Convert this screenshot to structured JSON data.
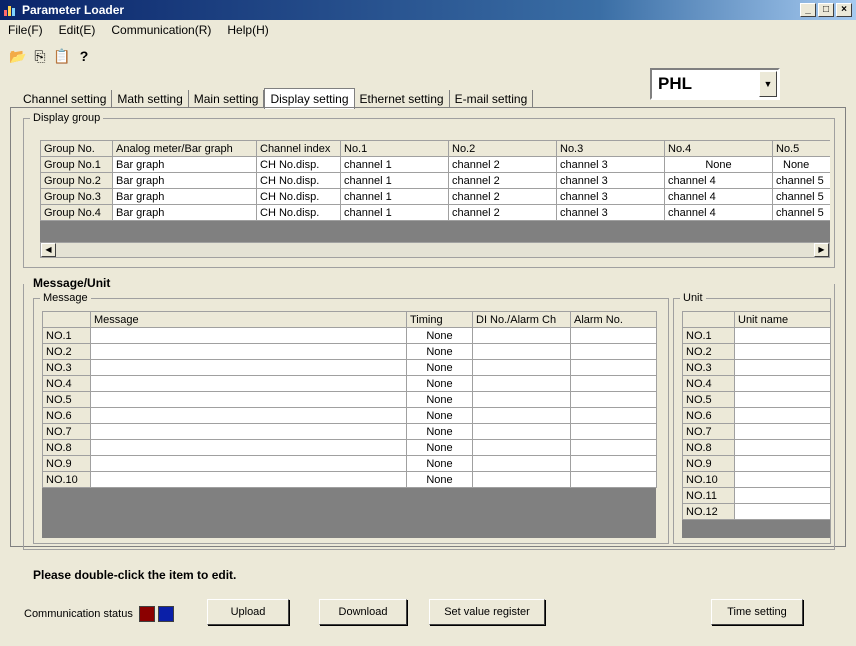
{
  "window": {
    "title": "Parameter Loader",
    "buttons": [
      "_",
      "□",
      "×"
    ]
  },
  "menu": [
    "File(F)",
    "Edit(E)",
    "Communication(R)",
    "Help(H)"
  ],
  "toolbar": {
    "icons": [
      "open-folder-icon",
      "copy-icon",
      "paste-icon",
      "help-icon"
    ],
    "glyphs": [
      "📂",
      "⎘",
      "📋",
      "?"
    ]
  },
  "model_select": {
    "value": "PHL"
  },
  "tabs": [
    {
      "label": "Channel setting",
      "active": false
    },
    {
      "label": "Math setting",
      "active": false
    },
    {
      "label": "Main setting",
      "active": false
    },
    {
      "label": "Display setting",
      "active": true
    },
    {
      "label": "Ethernet setting",
      "active": false
    },
    {
      "label": "E-mail setting",
      "active": false
    }
  ],
  "display_group": {
    "label": "Display group",
    "headers": [
      "Group No.",
      "Analog meter/Bar graph",
      "Channel index",
      "No.1",
      "No.2",
      "No.3",
      "No.4",
      "No.5"
    ],
    "rows": [
      [
        "Group No.1",
        "Bar graph",
        "CH No.disp.",
        "channel 1",
        "channel 2",
        "channel 3",
        "None",
        "None"
      ],
      [
        "Group No.2",
        "Bar graph",
        "CH No.disp.",
        "channel 1",
        "channel 2",
        "channel 3",
        "channel 4",
        "channel 5"
      ],
      [
        "Group No.3",
        "Bar graph",
        "CH No.disp.",
        "channel 1",
        "channel 2",
        "channel 3",
        "channel 4",
        "channel 5"
      ],
      [
        "Group No.4",
        "Bar graph",
        "CH No.disp.",
        "channel 1",
        "channel 2",
        "channel 3",
        "channel 4",
        "channel 5"
      ]
    ]
  },
  "message_unit": {
    "label": "Message/Unit",
    "message": {
      "label": "Message",
      "headers": [
        "",
        "Message",
        "Timing",
        "DI No./Alarm Ch",
        "Alarm No."
      ],
      "rows": [
        [
          "NO.1",
          "",
          "None",
          "",
          ""
        ],
        [
          "NO.2",
          "",
          "None",
          "",
          ""
        ],
        [
          "NO.3",
          "",
          "None",
          "",
          ""
        ],
        [
          "NO.4",
          "",
          "None",
          "",
          ""
        ],
        [
          "NO.5",
          "",
          "None",
          "",
          ""
        ],
        [
          "NO.6",
          "",
          "None",
          "",
          ""
        ],
        [
          "NO.7",
          "",
          "None",
          "",
          ""
        ],
        [
          "NO.8",
          "",
          "None",
          "",
          ""
        ],
        [
          "NO.9",
          "",
          "None",
          "",
          ""
        ],
        [
          "NO.10",
          "",
          "None",
          "",
          ""
        ]
      ]
    },
    "unit": {
      "label": "Unit",
      "headers": [
        "",
        "Unit name"
      ],
      "rows": [
        "NO.1",
        "NO.2",
        "NO.3",
        "NO.4",
        "NO.5",
        "NO.6",
        "NO.7",
        "NO.8",
        "NO.9",
        "NO.10",
        "NO.11",
        "NO.12"
      ]
    }
  },
  "hint": "Please double-click the item to edit.",
  "status": {
    "label": "Communication status",
    "colors": [
      "#8b0000",
      "#0a1fa8"
    ]
  },
  "buttons": {
    "upload": "Upload",
    "download": "Download",
    "set_value_register": "Set value register",
    "time_setting": "Time setting"
  }
}
